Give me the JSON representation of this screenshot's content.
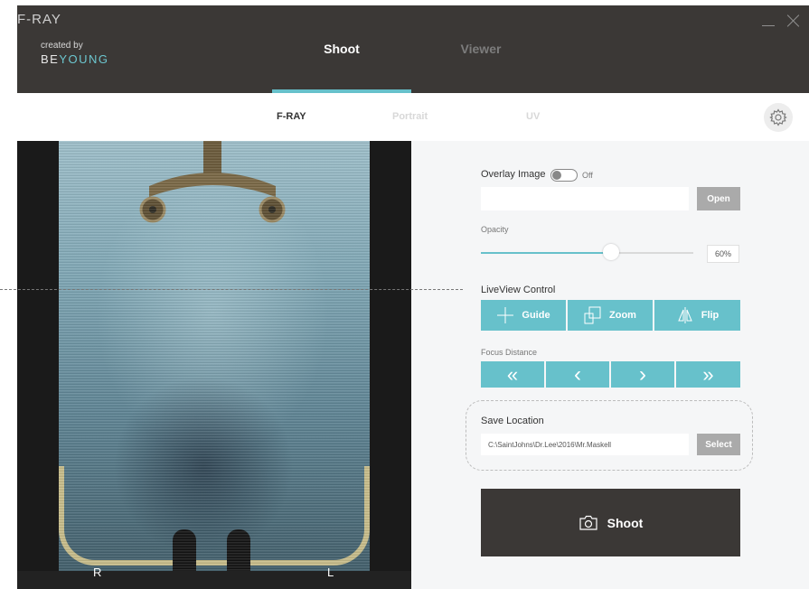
{
  "window": {
    "app_title": "F-RAY",
    "created_by": "created by",
    "brand_part1": "BE",
    "brand_part2": "YOUNG",
    "minimize_icon": "minimize-icon",
    "close_icon": "close-icon"
  },
  "main_tabs": [
    {
      "label": "Shoot",
      "active": true
    },
    {
      "label": "Viewer",
      "active": false
    }
  ],
  "sub_tabs": [
    {
      "label": "F-RAY",
      "active": true
    },
    {
      "label": "Portrait",
      "active": false
    },
    {
      "label": "UV",
      "active": false
    }
  ],
  "settings_icon": "gear-icon",
  "preview": {
    "left_marker": "R",
    "right_marker": "L"
  },
  "overlay": {
    "label": "Overlay Image",
    "toggle_state": "Off",
    "path_value": "",
    "open_button": "Open"
  },
  "opacity": {
    "label": "Opacity",
    "value_text": "60%",
    "value": 0.6
  },
  "liveview": {
    "label": "LiveView Control",
    "buttons": [
      {
        "label": "Guide",
        "icon": "crosshair-icon"
      },
      {
        "label": "Zoom",
        "icon": "zoom-squares-icon"
      },
      {
        "label": "Flip",
        "icon": "flip-icon"
      }
    ]
  },
  "focus": {
    "label": "Focus Distance",
    "buttons": [
      {
        "icon": "double-chevron-left-icon",
        "glyph": "«"
      },
      {
        "icon": "chevron-left-icon",
        "glyph": "‹"
      },
      {
        "icon": "chevron-right-icon",
        "glyph": "›"
      },
      {
        "icon": "double-chevron-right-icon",
        "glyph": "»"
      }
    ]
  },
  "save_location": {
    "label": "Save Location",
    "path": "C:\\SaintJohns\\Dr.Lee\\2016\\Mr.Maskell",
    "select_button": "Select"
  },
  "shoot": {
    "label": "Shoot",
    "icon": "camera-icon"
  },
  "colors": {
    "accent": "#67c1cb",
    "header": "#3b3836",
    "button_gray": "#aaaaaa"
  }
}
